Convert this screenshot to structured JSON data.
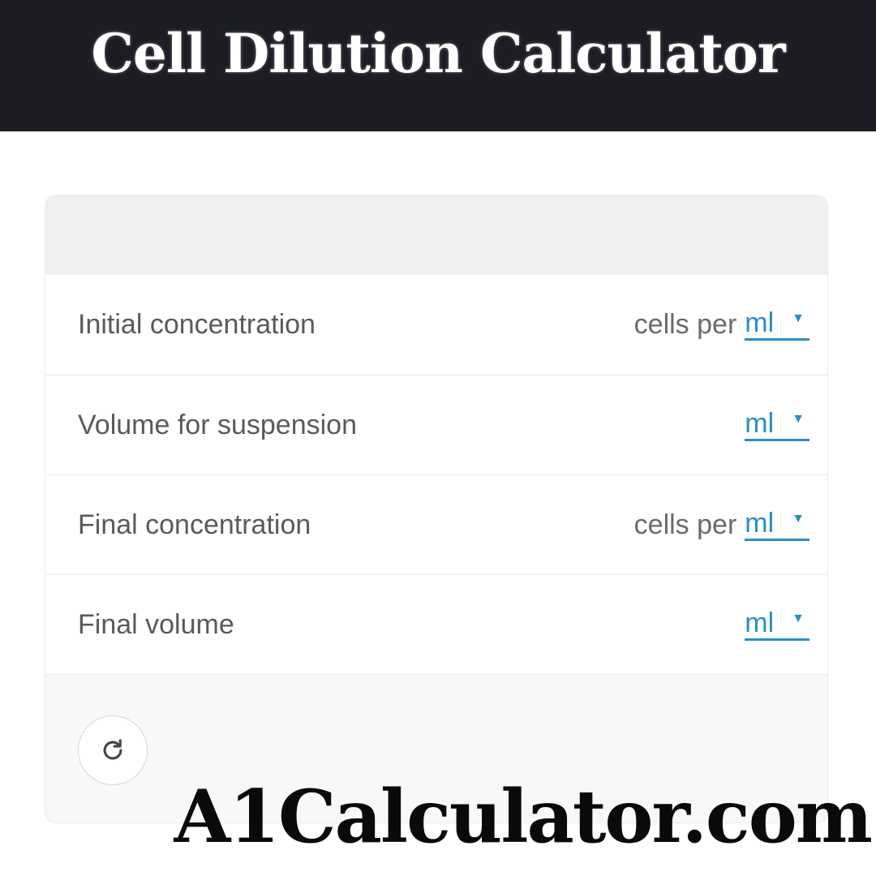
{
  "header": {
    "title": "Cell Dilution Calculator"
  },
  "colors": {
    "header_bg": "#1b1c24",
    "link": "#2a8fc4"
  },
  "rows": [
    {
      "label": "Initial concentration",
      "unit_prefix": "cells per",
      "unit": "ml",
      "caret_icon": "caret-down-icon"
    },
    {
      "label": "Volume for suspension",
      "unit_prefix": "",
      "unit": "ml",
      "caret_icon": "caret-down-icon"
    },
    {
      "label": "Final concentration",
      "unit_prefix": "cells per",
      "unit": "ml",
      "caret_icon": "caret-down-icon"
    },
    {
      "label": "Final volume",
      "unit_prefix": "",
      "unit": "ml",
      "caret_icon": "caret-down-icon"
    }
  ],
  "footer": {
    "reset_icon": "refresh-icon"
  },
  "watermark": {
    "text": "A1Calculator.com"
  }
}
